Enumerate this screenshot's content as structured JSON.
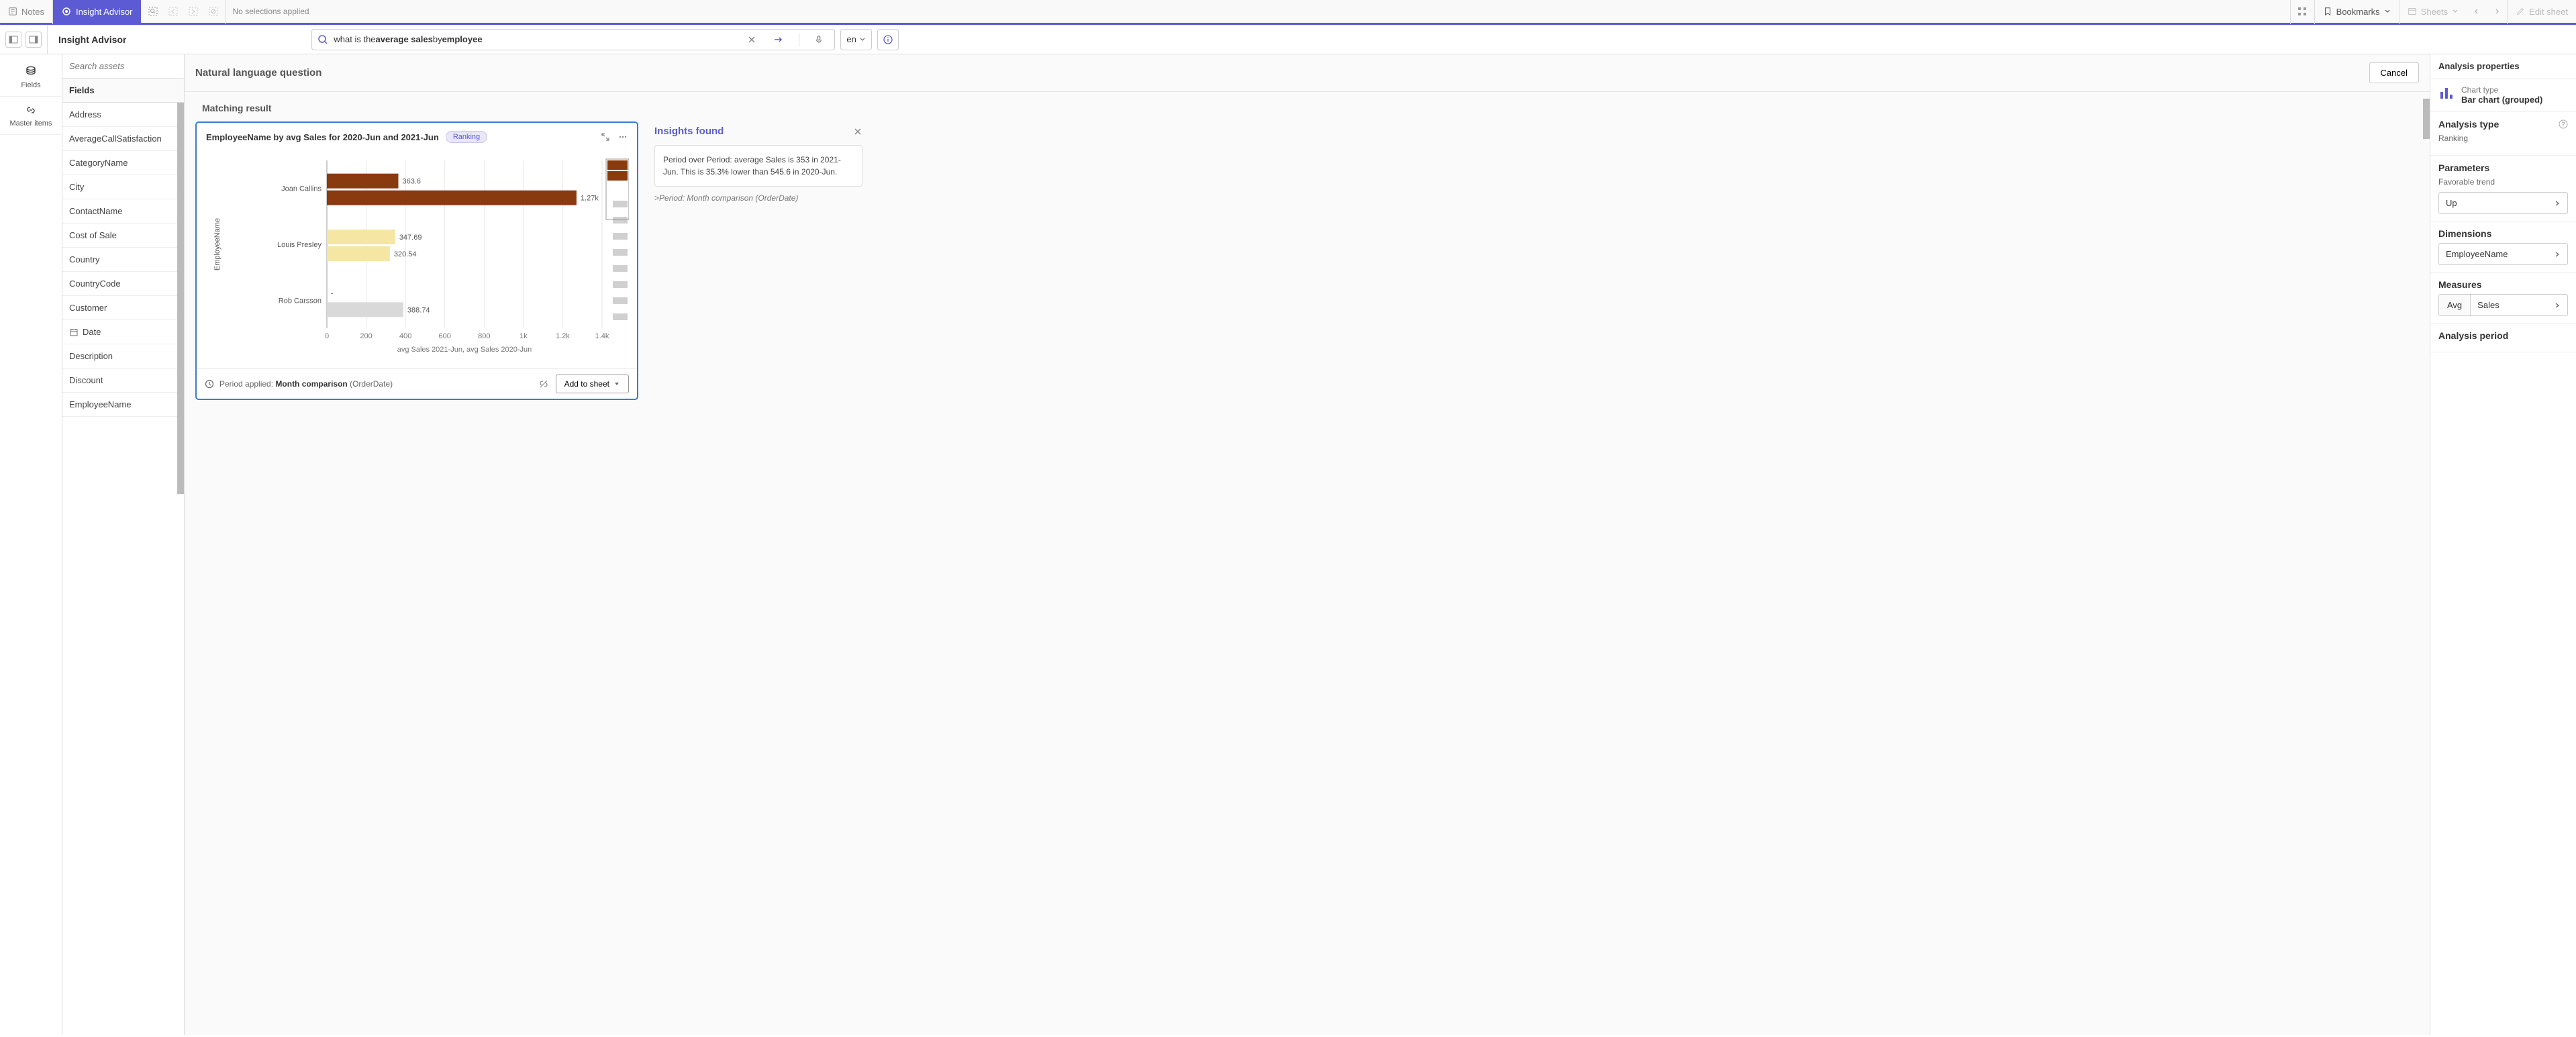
{
  "toolbar": {
    "notes_label": "Notes",
    "insight_advisor_label": "Insight Advisor",
    "no_selections": "No selections applied",
    "bookmarks_label": "Bookmarks",
    "sheets_label": "Sheets",
    "edit_sheet_label": "Edit sheet"
  },
  "subbar": {
    "title": "Insight Advisor",
    "search_prefix": "what is the ",
    "search_bold1": "average sales",
    "search_mid": " by ",
    "search_bold2": "employee",
    "search_value": "what is the average sales by employee",
    "lang": "en"
  },
  "rail": {
    "fields": "Fields",
    "master": "Master items"
  },
  "fields_panel": {
    "search_placeholder": "Search assets",
    "header": "Fields",
    "items": [
      "Address",
      "AverageCallSatisfaction",
      "CategoryName",
      "City",
      "ContactName",
      "Cost of Sale",
      "Country",
      "CountryCode",
      "Customer",
      "Date",
      "Description",
      "Discount",
      "EmployeeName"
    ]
  },
  "center": {
    "nlq_title": "Natural language question",
    "cancel": "Cancel",
    "matching": "Matching result",
    "chart": {
      "title": "EmployeeName by avg Sales for 2020-Jun and 2021-Jun",
      "tag": "Ranking",
      "ylabel": "EmployeeName",
      "xlabel": "avg Sales 2021-Jun, avg Sales 2020-Jun",
      "footer_label": "Period applied:",
      "footer_value": "Month comparison",
      "footer_paren": "(OrderDate)",
      "add_btn": "Add to sheet"
    },
    "insights": {
      "title": "Insights found",
      "text": "Period over Period: average Sales is 353 in 2021-Jun. This is 35.3% lower than 545.6 in 2020-Jun.",
      "meta_prefix": ">",
      "meta": "Period: Month comparison (OrderDate)"
    }
  },
  "props": {
    "header": "Analysis properties",
    "chart_type_label": "Chart type",
    "chart_type_value": "Bar chart (grouped)",
    "analysis_type_label": "Analysis type",
    "analysis_type_value": "Ranking",
    "parameters_label": "Parameters",
    "favorable_trend_label": "Favorable trend",
    "favorable_trend_value": "Up",
    "dimensions_label": "Dimensions",
    "dimension_value": "EmployeeName",
    "measures_label": "Measures",
    "measure_agg": "Avg",
    "measure_field": "Sales",
    "analysis_period_label": "Analysis period"
  },
  "chart_data": {
    "type": "bar",
    "orientation": "horizontal",
    "grouped": true,
    "categories": [
      "Joan Callins",
      "Louis Presley",
      "Rob Carsson"
    ],
    "series": [
      {
        "name": "avg Sales 2021-Jun",
        "values": [
          363.6,
          347.69,
          null
        ],
        "color": "#8a3a0f",
        "color_light": "#f5e6a3"
      },
      {
        "name": "avg Sales 2020-Jun",
        "values": [
          1270,
          320.54,
          388.74
        ],
        "color": "#8a3a0f",
        "color_light": "#f5e6a3"
      }
    ],
    "display_labels": [
      [
        "363.6",
        "1.27k"
      ],
      [
        "347.69",
        "320.54"
      ],
      [
        "-",
        "388.74"
      ]
    ],
    "bar_colors": [
      [
        "#8a3a0f",
        "#8a3a0f"
      ],
      [
        "#f5e6a3",
        "#f5e6a3"
      ],
      [
        "#ffffff",
        "#d9d9d9"
      ]
    ],
    "xlim": [
      0,
      1400
    ],
    "xticks": [
      0,
      200,
      400,
      600,
      800,
      1000,
      1200,
      1400
    ],
    "xtick_labels": [
      "0",
      "200",
      "400",
      "600",
      "800",
      "1k",
      "1.2k",
      "1.4k"
    ],
    "ylabel": "EmployeeName",
    "xlabel": "avg Sales 2021-Jun, avg Sales 2020-Jun",
    "minimap": true
  }
}
